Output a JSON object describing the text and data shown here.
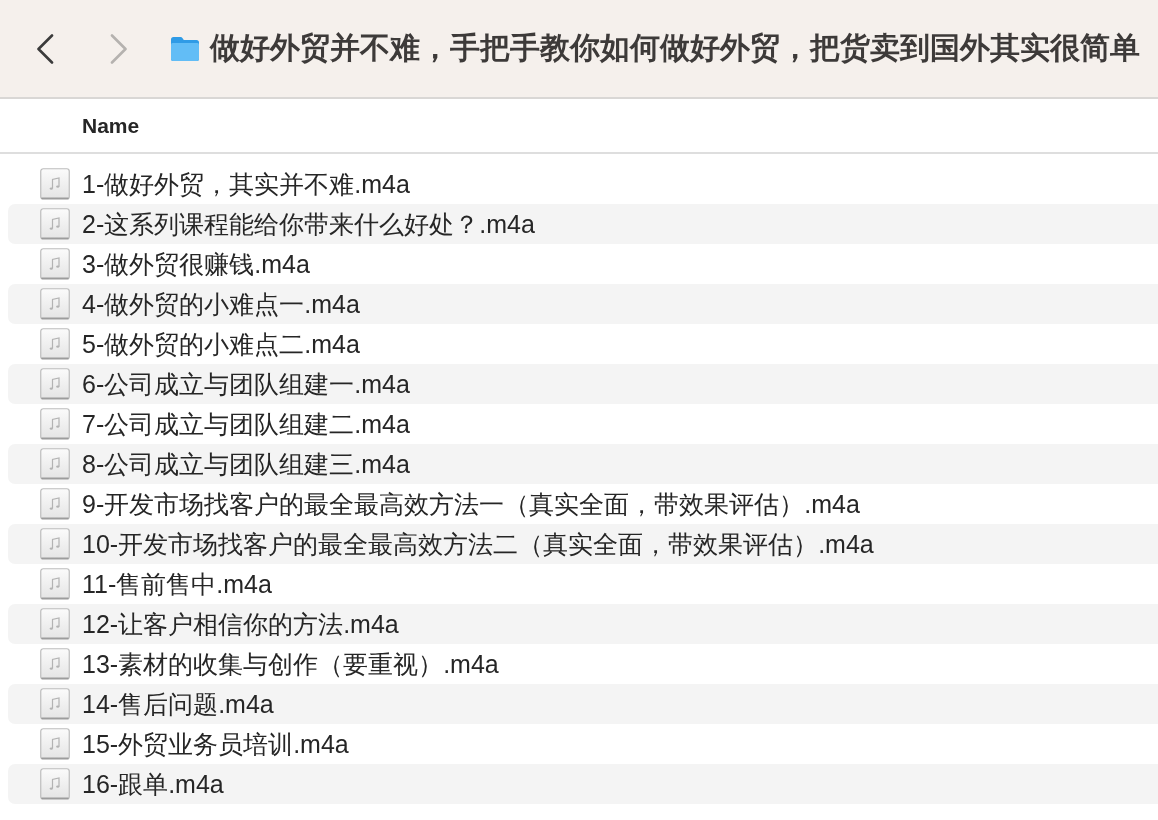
{
  "window": {
    "title": "做好外贸并不难，手把手教你如何做好外贸，把货卖到国外其实很简单"
  },
  "navigation": {
    "back": {
      "disabled": false
    },
    "forward": {
      "disabled": true
    }
  },
  "columns": [
    {
      "label": "Name"
    }
  ],
  "rows": [
    {
      "name": "1-做好外贸，其实并不难.m4a"
    },
    {
      "name": "2-这系列课程能给你带来什么好处？.m4a"
    },
    {
      "name": "3-做外贸很赚钱.m4a"
    },
    {
      "name": "4-做外贸的小难点一.m4a"
    },
    {
      "name": "5-做外贸的小难点二.m4a"
    },
    {
      "name": "6-公司成立与团队组建一.m4a"
    },
    {
      "name": "7-公司成立与团队组建二.m4a"
    },
    {
      "name": "8-公司成立与团队组建三.m4a"
    },
    {
      "name": "9-开发市场找客户的最全最高效方法一（真实全面，带效果评估）.m4a"
    },
    {
      "name": "10-开发市场找客户的最全最高效方法二（真实全面，带效果评估）.m4a"
    },
    {
      "name": "11-售前售中.m4a"
    },
    {
      "name": "12-让客户相信你的方法.m4a"
    },
    {
      "name": "13-素材的收集与创作（要重视）.m4a"
    },
    {
      "name": "14-售后问题.m4a"
    },
    {
      "name": "15-外贸业务员培训.m4a"
    },
    {
      "name": "16-跟单.m4a"
    }
  ]
}
